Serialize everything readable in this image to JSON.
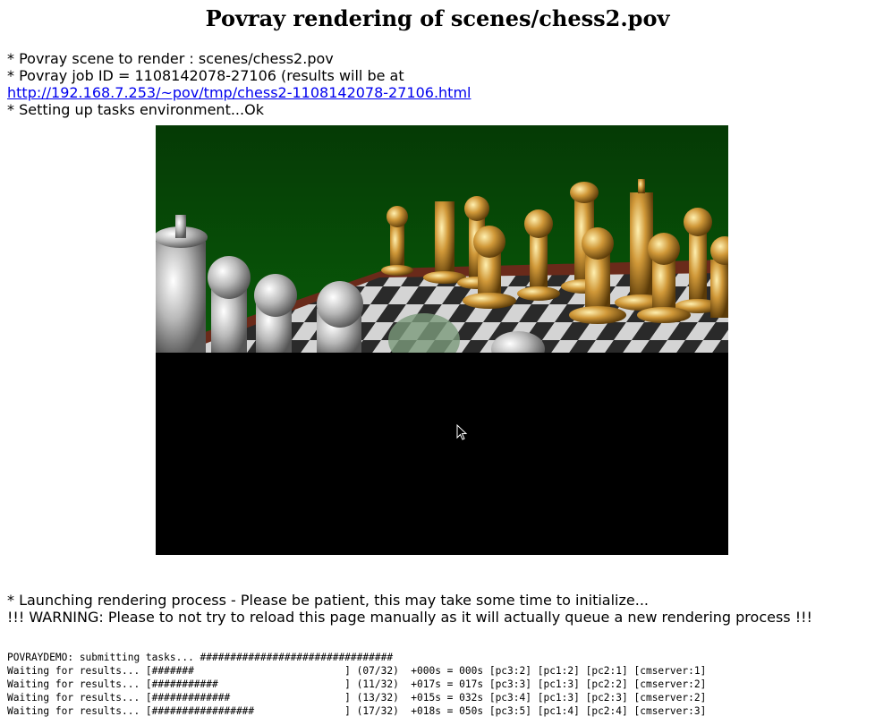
{
  "page": {
    "title": "Povray rendering of scenes/chess2.pov"
  },
  "status": {
    "scene": "* Povray scene to render : scenes/chess2.pov",
    "job_id": "* Povray job ID = 1108142078-27106 (results will be at",
    "result_url": "http://192.168.7.253/~pov/tmp/chess2-1108142078-27106.html",
    "setup": "* Setting up tasks environment...Ok"
  },
  "render": {
    "rendered_fraction": 0.53,
    "floor_color": "#c8c8c8",
    "backdrop_color": "#0a6a0a",
    "gold_color": "#c89030",
    "silver_color": "#d8d8d8"
  },
  "messages": {
    "launching": "* Launching rendering process - Please be patient, this may take some time to initialize...",
    "warning": "!!! WARNING: Please to not try to reload this page manually as it will actually queue a new rendering process !!!"
  },
  "log": {
    "lines": [
      "POVRAYDEMO: submitting tasks... ################################",
      "Waiting for results... [#######                         ] (07/32)  +000s = 000s [pc3:2] [pc1:2] [pc2:1] [cmserver:1]",
      "Waiting for results... [###########                     ] (11/32)  +017s = 017s [pc3:3] [pc1:3] [pc2:2] [cmserver:2]",
      "Waiting for results... [#############                   ] (13/32)  +015s = 032s [pc3:4] [pc1:3] [pc2:3] [cmserver:2]",
      "Waiting for results... [#################               ] (17/32)  +018s = 050s [pc3:5] [pc1:4] [pc2:4] [cmserver:3]"
    ]
  }
}
